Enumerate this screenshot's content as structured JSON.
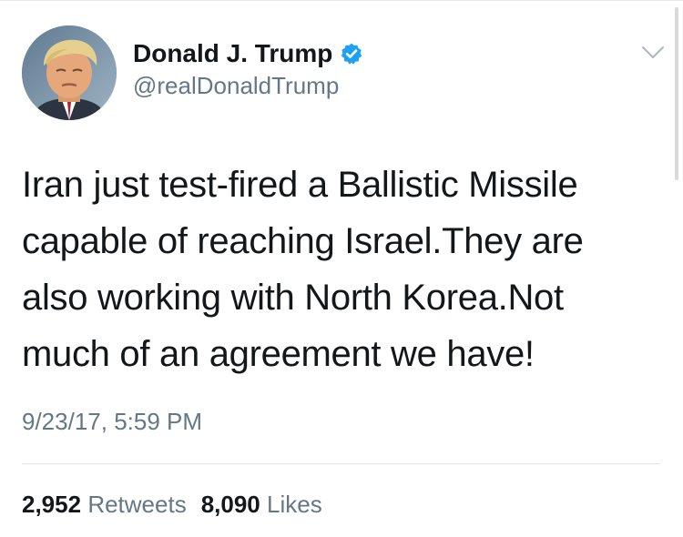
{
  "tweet": {
    "author": {
      "display_name": "Donald J. Trump",
      "handle": "@realDonaldTrump",
      "verified": true
    },
    "text": "Iran just test-fired a Ballistic Missile capable of reaching Israel.They are also working with North Korea.Not much of an agreement we have!",
    "timestamp": "9/23/17, 5:59 PM",
    "stats": {
      "retweets_count": "2,952",
      "retweets_label": "Retweets",
      "likes_count": "8,090",
      "likes_label": "Likes"
    }
  },
  "icons": {
    "verified": "verified-badge-icon",
    "menu": "chevron-down-icon"
  },
  "colors": {
    "primary_text": "#14171a",
    "secondary_text": "#657786",
    "verified_blue": "#1da1f2",
    "divider": "#e1e8ed"
  }
}
